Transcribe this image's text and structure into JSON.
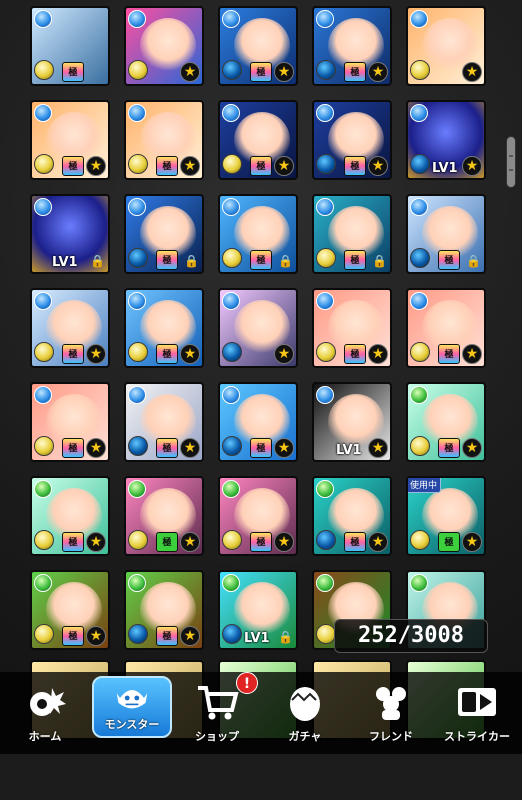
{
  "inventory": {
    "counter": "252/3008"
  },
  "labels": {
    "level": "LV1",
    "in_use": "使用中",
    "gokyo": "極"
  },
  "nav": {
    "items": [
      {
        "label": "ホーム",
        "icon": "home-gear-icon"
      },
      {
        "label": "モンスター",
        "icon": "monster-icon"
      },
      {
        "label": "ショップ",
        "icon": "cart-icon"
      },
      {
        "label": "ガチャ",
        "icon": "egg-icon"
      },
      {
        "label": "フレンド",
        "icon": "friends-icon"
      },
      {
        "label": "ストライカー",
        "icon": "striker-card-icon"
      }
    ],
    "shop_badge": "!"
  }
}
